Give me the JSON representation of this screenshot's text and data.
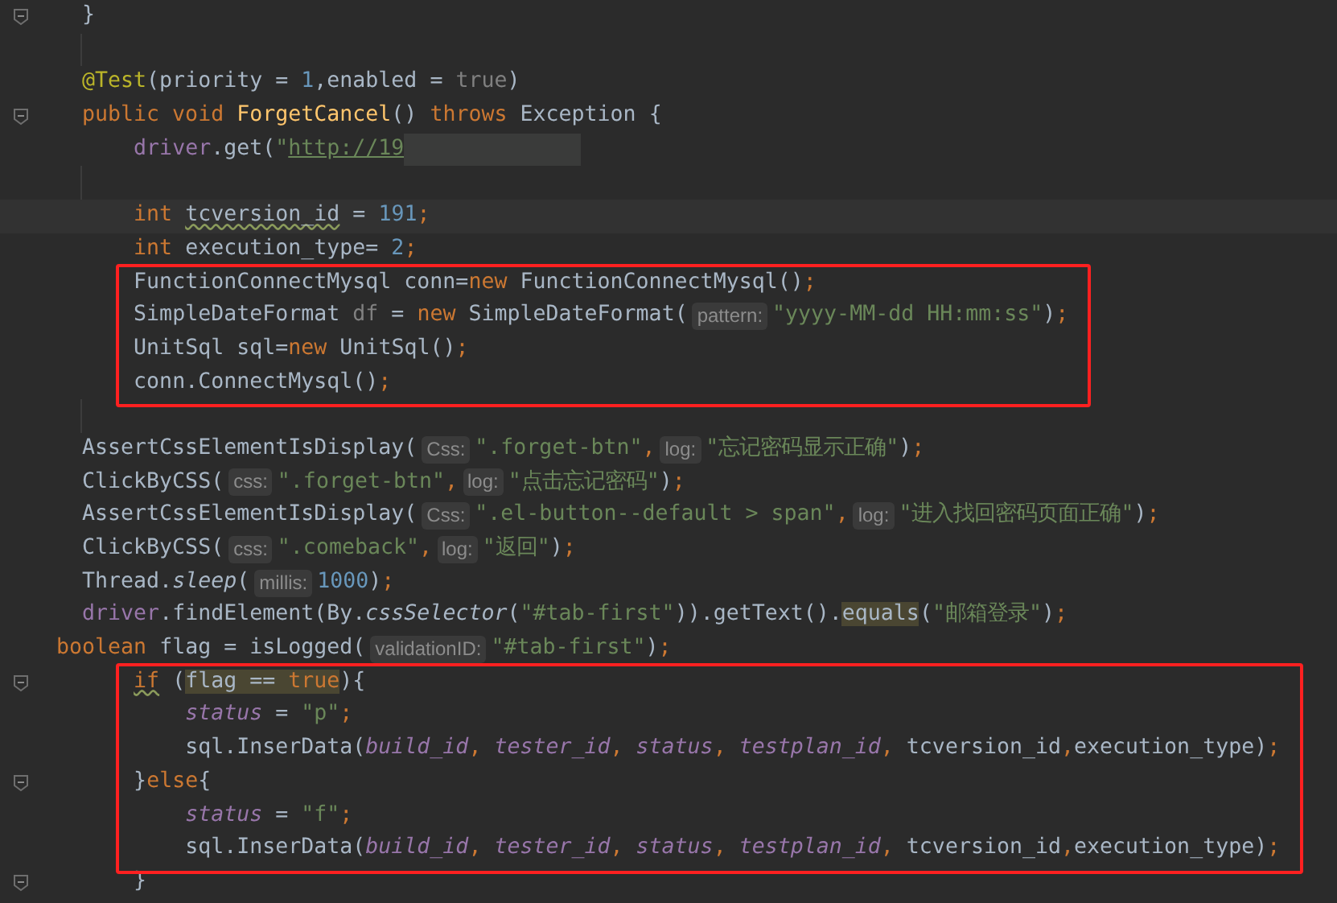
{
  "editor": {
    "blocks": [
      {
        "lines": [
          {
            "fold": true,
            "tokens": [
              {
                "text": "  }",
                "kind": "plain"
              }
            ]
          },
          {
            "kind": "blank"
          },
          {
            "tokens": [
              {
                "text": "  @Test",
                "kind": "annotation"
              },
              {
                "text": "(priority = ",
                "kind": "plain"
              },
              {
                "text": "1",
                "kind": "number"
              },
              {
                "text": ",enabled = ",
                "kind": "plain"
              },
              {
                "text": "true",
                "kind": "dim"
              },
              {
                "text": ")",
                "kind": "plain"
              }
            ]
          },
          {
            "fold": true,
            "tokens": [
              {
                "text": "  public void ",
                "kind": "keyword"
              },
              {
                "text": "ForgetCancel",
                "kind": "method"
              },
              {
                "text": "() ",
                "kind": "plain"
              },
              {
                "text": "throws",
                "kind": "keyword"
              },
              {
                "text": " Exception {",
                "kind": "plain"
              }
            ]
          },
          {
            "tokens": [
              {
                "text": "      driver",
                "kind": "field"
              },
              {
                "text": ".get(",
                "kind": "plain"
              },
              {
                "text": "\"",
                "kind": "string"
              },
              {
                "text": "http://19",
                "kind": "string",
                "link": true
              },
              {
                "kind": "redacted"
              }
            ]
          },
          {
            "kind": "blank"
          },
          {
            "current": true,
            "tokens": [
              {
                "text": "      int ",
                "kind": "keyword"
              },
              {
                "text": "tcversion_id",
                "kind": "plain",
                "warning": true
              },
              {
                "text": " = ",
                "kind": "plain"
              },
              {
                "text": "191",
                "kind": "number"
              },
              {
                "text": ";",
                "kind": "keyword"
              }
            ]
          },
          {
            "tokens": [
              {
                "text": "      int ",
                "kind": "keyword"
              },
              {
                "text": "execution_type= ",
                "kind": "plain"
              },
              {
                "text": "2",
                "kind": "number"
              },
              {
                "text": ";",
                "kind": "keyword"
              }
            ]
          }
        ]
      },
      {
        "boxed": true,
        "lines": [
          {
            "tokens": [
              {
                "text": "      FunctionConnectMysql conn=",
                "kind": "plain"
              },
              {
                "text": "new",
                "kind": "keyword"
              },
              {
                "text": " FunctionConnectMysql()",
                "kind": "plain"
              },
              {
                "text": ";",
                "kind": "keyword"
              }
            ]
          },
          {
            "tokens": [
              {
                "text": "      SimpleDateFormat ",
                "kind": "plain"
              },
              {
                "text": "df",
                "kind": "dim"
              },
              {
                "text": " = ",
                "kind": "plain"
              },
              {
                "text": "new",
                "kind": "keyword"
              },
              {
                "text": " SimpleDateFormat(",
                "kind": "plain"
              },
              {
                "text": "pattern:",
                "kind": "hint"
              },
              {
                "text": "\"yyyy-MM-dd HH:mm:ss\"",
                "kind": "string"
              },
              {
                "text": ")",
                "kind": "plain"
              },
              {
                "text": ";",
                "kind": "keyword"
              }
            ]
          },
          {
            "tokens": [
              {
                "text": "      UnitSql sql=",
                "kind": "plain"
              },
              {
                "text": "new",
                "kind": "keyword"
              },
              {
                "text": " UnitSql()",
                "kind": "plain"
              },
              {
                "text": ";",
                "kind": "keyword"
              }
            ]
          },
          {
            "tokens": [
              {
                "text": "      conn.ConnectMysql()",
                "kind": "plain"
              },
              {
                "text": ";",
                "kind": "keyword"
              }
            ]
          }
        ]
      },
      {
        "lines": [
          {
            "kind": "blank"
          },
          {
            "tokens": [
              {
                "text": "  AssertCssElementIsDisplay(",
                "kind": "plain"
              },
              {
                "text": "Css:",
                "kind": "hint"
              },
              {
                "text": "\".forget-btn\"",
                "kind": "string"
              },
              {
                "text": ",",
                "kind": "keyword"
              },
              {
                "text": "log:",
                "kind": "hint"
              },
              {
                "text": "\"忘记密码显示正确\"",
                "kind": "string"
              },
              {
                "text": ")",
                "kind": "plain"
              },
              {
                "text": ";",
                "kind": "keyword"
              }
            ]
          },
          {
            "tokens": [
              {
                "text": "  ClickByCSS(",
                "kind": "plain"
              },
              {
                "text": "css:",
                "kind": "hint"
              },
              {
                "text": "\".forget-btn\"",
                "kind": "string"
              },
              {
                "text": ",",
                "kind": "keyword"
              },
              {
                "text": "log:",
                "kind": "hint"
              },
              {
                "text": "\"点击忘记密码\"",
                "kind": "string"
              },
              {
                "text": ")",
                "kind": "plain"
              },
              {
                "text": ";",
                "kind": "keyword"
              }
            ]
          },
          {
            "tokens": [
              {
                "text": "  AssertCssElementIsDisplay(",
                "kind": "plain"
              },
              {
                "text": "Css:",
                "kind": "hint"
              },
              {
                "text": "\".el-button--default > span\"",
                "kind": "string"
              },
              {
                "text": ",",
                "kind": "keyword"
              },
              {
                "text": "log:",
                "kind": "hint"
              },
              {
                "text": "\"进入找回密码页面正确\"",
                "kind": "string"
              },
              {
                "text": ")",
                "kind": "plain"
              },
              {
                "text": ";",
                "kind": "keyword"
              }
            ]
          },
          {
            "tokens": [
              {
                "text": "  ClickByCSS(",
                "kind": "plain"
              },
              {
                "text": "css:",
                "kind": "hint"
              },
              {
                "text": "\".comeback\"",
                "kind": "string"
              },
              {
                "text": ",",
                "kind": "keyword"
              },
              {
                "text": "log:",
                "kind": "hint"
              },
              {
                "text": "\"返回\"",
                "kind": "string"
              },
              {
                "text": ")",
                "kind": "plain"
              },
              {
                "text": ";",
                "kind": "keyword"
              }
            ]
          },
          {
            "tokens": [
              {
                "text": "  Thread.",
                "kind": "plain"
              },
              {
                "text": "sleep",
                "kind": "static"
              },
              {
                "text": "(",
                "kind": "plain"
              },
              {
                "text": "millis:",
                "kind": "hint"
              },
              {
                "text": "1000",
                "kind": "number"
              },
              {
                "text": ")",
                "kind": "plain"
              },
              {
                "text": ";",
                "kind": "keyword"
              }
            ]
          },
          {
            "tokens": [
              {
                "text": "  driver",
                "kind": "field"
              },
              {
                "text": ".findElement(By.",
                "kind": "plain"
              },
              {
                "text": "cssSelector",
                "kind": "static"
              },
              {
                "text": "(",
                "kind": "plain"
              },
              {
                "text": "\"#tab-first\"",
                "kind": "string"
              },
              {
                "text": ")).getText().",
                "kind": "plain"
              },
              {
                "text": "equals",
                "kind": "plain",
                "highlighted": true
              },
              {
                "text": "(",
                "kind": "plain"
              },
              {
                "text": "\"邮箱登录\"",
                "kind": "string"
              },
              {
                "text": ")",
                "kind": "plain"
              },
              {
                "text": ";",
                "kind": "keyword"
              }
            ]
          },
          {
            "tokens": [
              {
                "text": "boolean",
                "kind": "keyword"
              },
              {
                "text": " flag = isLogged(",
                "kind": "plain"
              },
              {
                "text": "validationID:",
                "kind": "hint"
              },
              {
                "text": "\"#tab-first\"",
                "kind": "string"
              },
              {
                "text": ")",
                "kind": "plain"
              },
              {
                "text": ";",
                "kind": "keyword"
              }
            ]
          }
        ]
      },
      {
        "boxed": true,
        "lines": [
          {
            "fold": true,
            "tokens": [
              {
                "text": "      if",
                "kind": "keyword",
                "warning": true
              },
              {
                "text": " (",
                "kind": "plain"
              },
              {
                "text": "flag == ",
                "kind": "plain",
                "highlighted": true
              },
              {
                "text": "true",
                "kind": "keyword",
                "highlighted": true
              },
              {
                "text": "){",
                "kind": "plain"
              }
            ]
          },
          {
            "tokens": [
              {
                "text": "          status",
                "kind": "param"
              },
              {
                "text": " = ",
                "kind": "plain"
              },
              {
                "text": "\"p\"",
                "kind": "string"
              },
              {
                "text": ";",
                "kind": "keyword"
              }
            ]
          },
          {
            "tokens": [
              {
                "text": "          sql.InserData(",
                "kind": "plain"
              },
              {
                "text": "build_id",
                "kind": "param"
              },
              {
                "text": ", ",
                "kind": "keyword"
              },
              {
                "text": "tester_id",
                "kind": "param"
              },
              {
                "text": ", ",
                "kind": "keyword"
              },
              {
                "text": "status",
                "kind": "param"
              },
              {
                "text": ", ",
                "kind": "keyword"
              },
              {
                "text": "testplan_id",
                "kind": "param"
              },
              {
                "text": ", ",
                "kind": "keyword"
              },
              {
                "text": "tcversion_id",
                "kind": "plain"
              },
              {
                "text": ",",
                "kind": "keyword"
              },
              {
                "text": "execution_type)",
                "kind": "plain"
              },
              {
                "text": ";",
                "kind": "keyword"
              }
            ]
          },
          {
            "fold": true,
            "tokens": [
              {
                "text": "      }",
                "kind": "plain"
              },
              {
                "text": "else",
                "kind": "keyword"
              },
              {
                "text": "{",
                "kind": "plain"
              }
            ]
          },
          {
            "tokens": [
              {
                "text": "          status",
                "kind": "param"
              },
              {
                "text": " = ",
                "kind": "plain"
              },
              {
                "text": "\"f\"",
                "kind": "string"
              },
              {
                "text": ";",
                "kind": "keyword"
              }
            ]
          },
          {
            "tokens": [
              {
                "text": "          sql.InserData(",
                "kind": "plain"
              },
              {
                "text": "build_id",
                "kind": "param"
              },
              {
                "text": ", ",
                "kind": "keyword"
              },
              {
                "text": "tester_id",
                "kind": "param"
              },
              {
                "text": ", ",
                "kind": "keyword"
              },
              {
                "text": "status",
                "kind": "param"
              },
              {
                "text": ", ",
                "kind": "keyword"
              },
              {
                "text": "testplan_id",
                "kind": "param"
              },
              {
                "text": ", ",
                "kind": "keyword"
              },
              {
                "text": "tcversion_id",
                "kind": "plain"
              },
              {
                "text": ",",
                "kind": "keyword"
              },
              {
                "text": "execution_type)",
                "kind": "plain"
              },
              {
                "text": ";",
                "kind": "keyword"
              }
            ]
          }
        ]
      },
      {
        "lines": [
          {
            "fold": true,
            "tokens": [
              {
                "text": "      }",
                "kind": "plain"
              }
            ]
          }
        ]
      }
    ]
  }
}
